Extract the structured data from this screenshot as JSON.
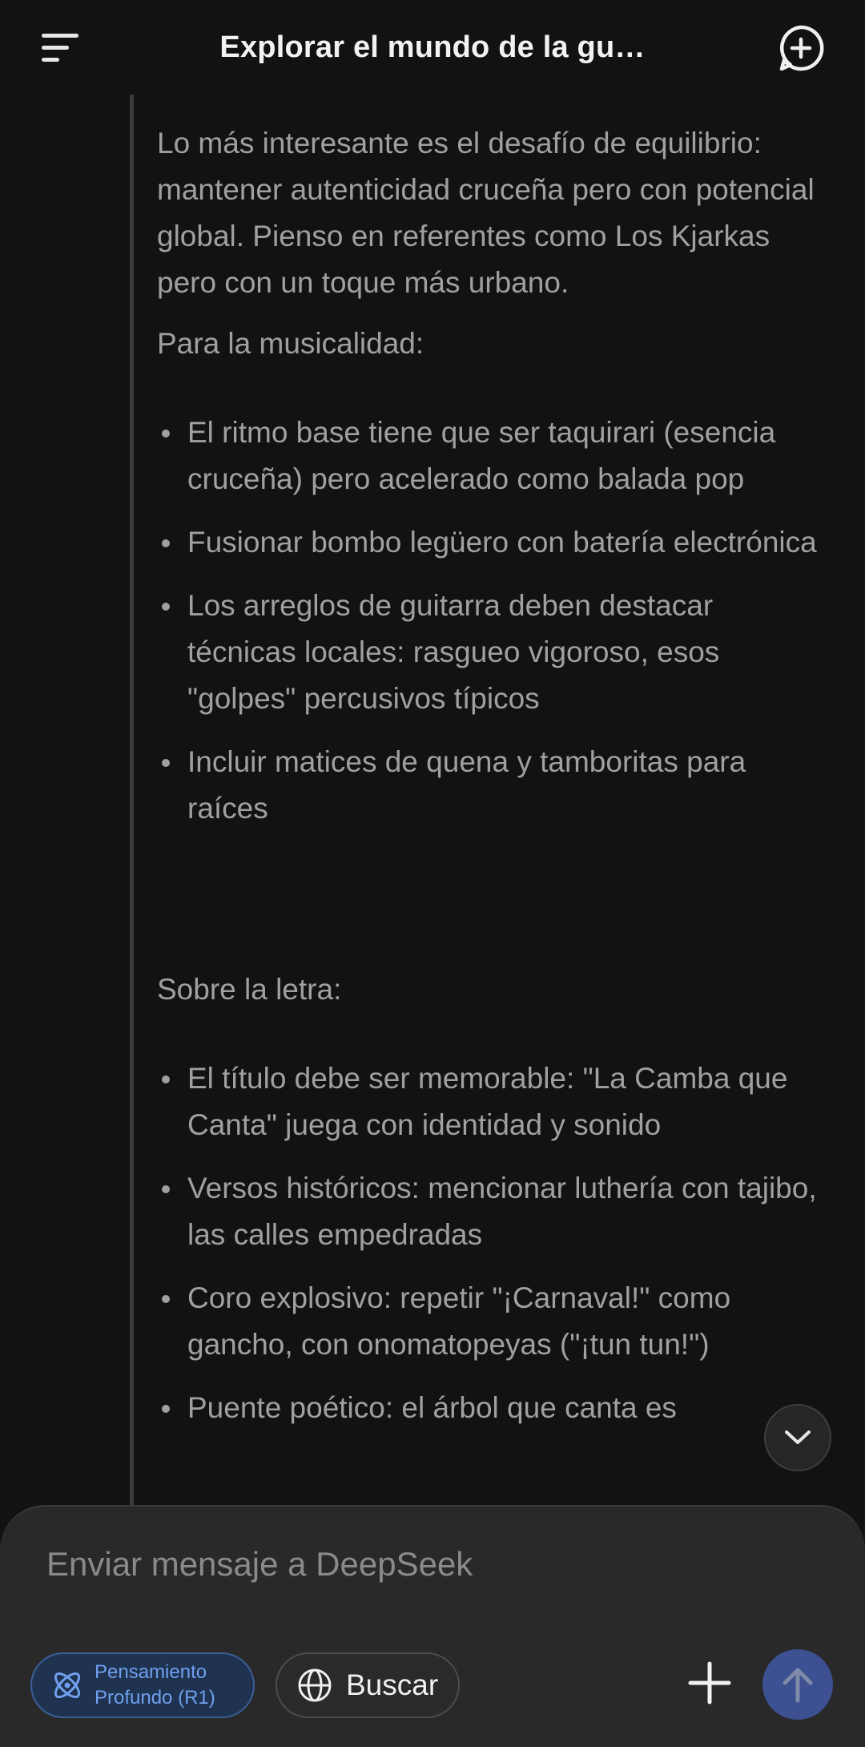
{
  "header": {
    "title": "Explorar el mundo de la gu…",
    "menu_icon": "menu-icon",
    "new_chat_icon": "new-chat-icon"
  },
  "thinking": {
    "intro": "Lo más interesante es el desafío de equilibrio: mantener autenticidad cruceña pero con potencial global. Pienso en referentes como Los Kjarkas pero con un toque más urbano.",
    "music_heading": "Para la musicalidad:",
    "music_items": [
      "El ritmo base tiene que ser taquirari (esencia cruceña) pero acelerado como balada pop",
      "Fusionar bombo legüero con batería electrónica",
      "Los arreglos de guitarra deben destacar técnicas locales: rasgueo vigoroso, esos \"golpes\" percusivos típicos",
      "Incluir matices de quena y tamboritas para raíces"
    ],
    "lyrics_heading": "Sobre la letra:",
    "lyrics_items": [
      "El título debe ser memorable: \"La Camba que Canta\" juega con identidad y sonido",
      "Versos históricos: mencionar luthería con tajibo, las calles empedradas",
      "Coro explosivo: repetir \"¡Carnaval!\" como gancho, con onomatopeyas (\"¡tun tun!\")",
      "Puente poético: el árbol que canta es"
    ]
  },
  "composer": {
    "placeholder": "Enviar mensaje a DeepSeek",
    "deep_think_line1": "Pensamiento",
    "deep_think_line2": "Profundo (R1)",
    "search_label": "Buscar"
  },
  "colors": {
    "background": "#121212",
    "accent": "#3d5192",
    "deep_think_text": "#6fa0ee"
  }
}
